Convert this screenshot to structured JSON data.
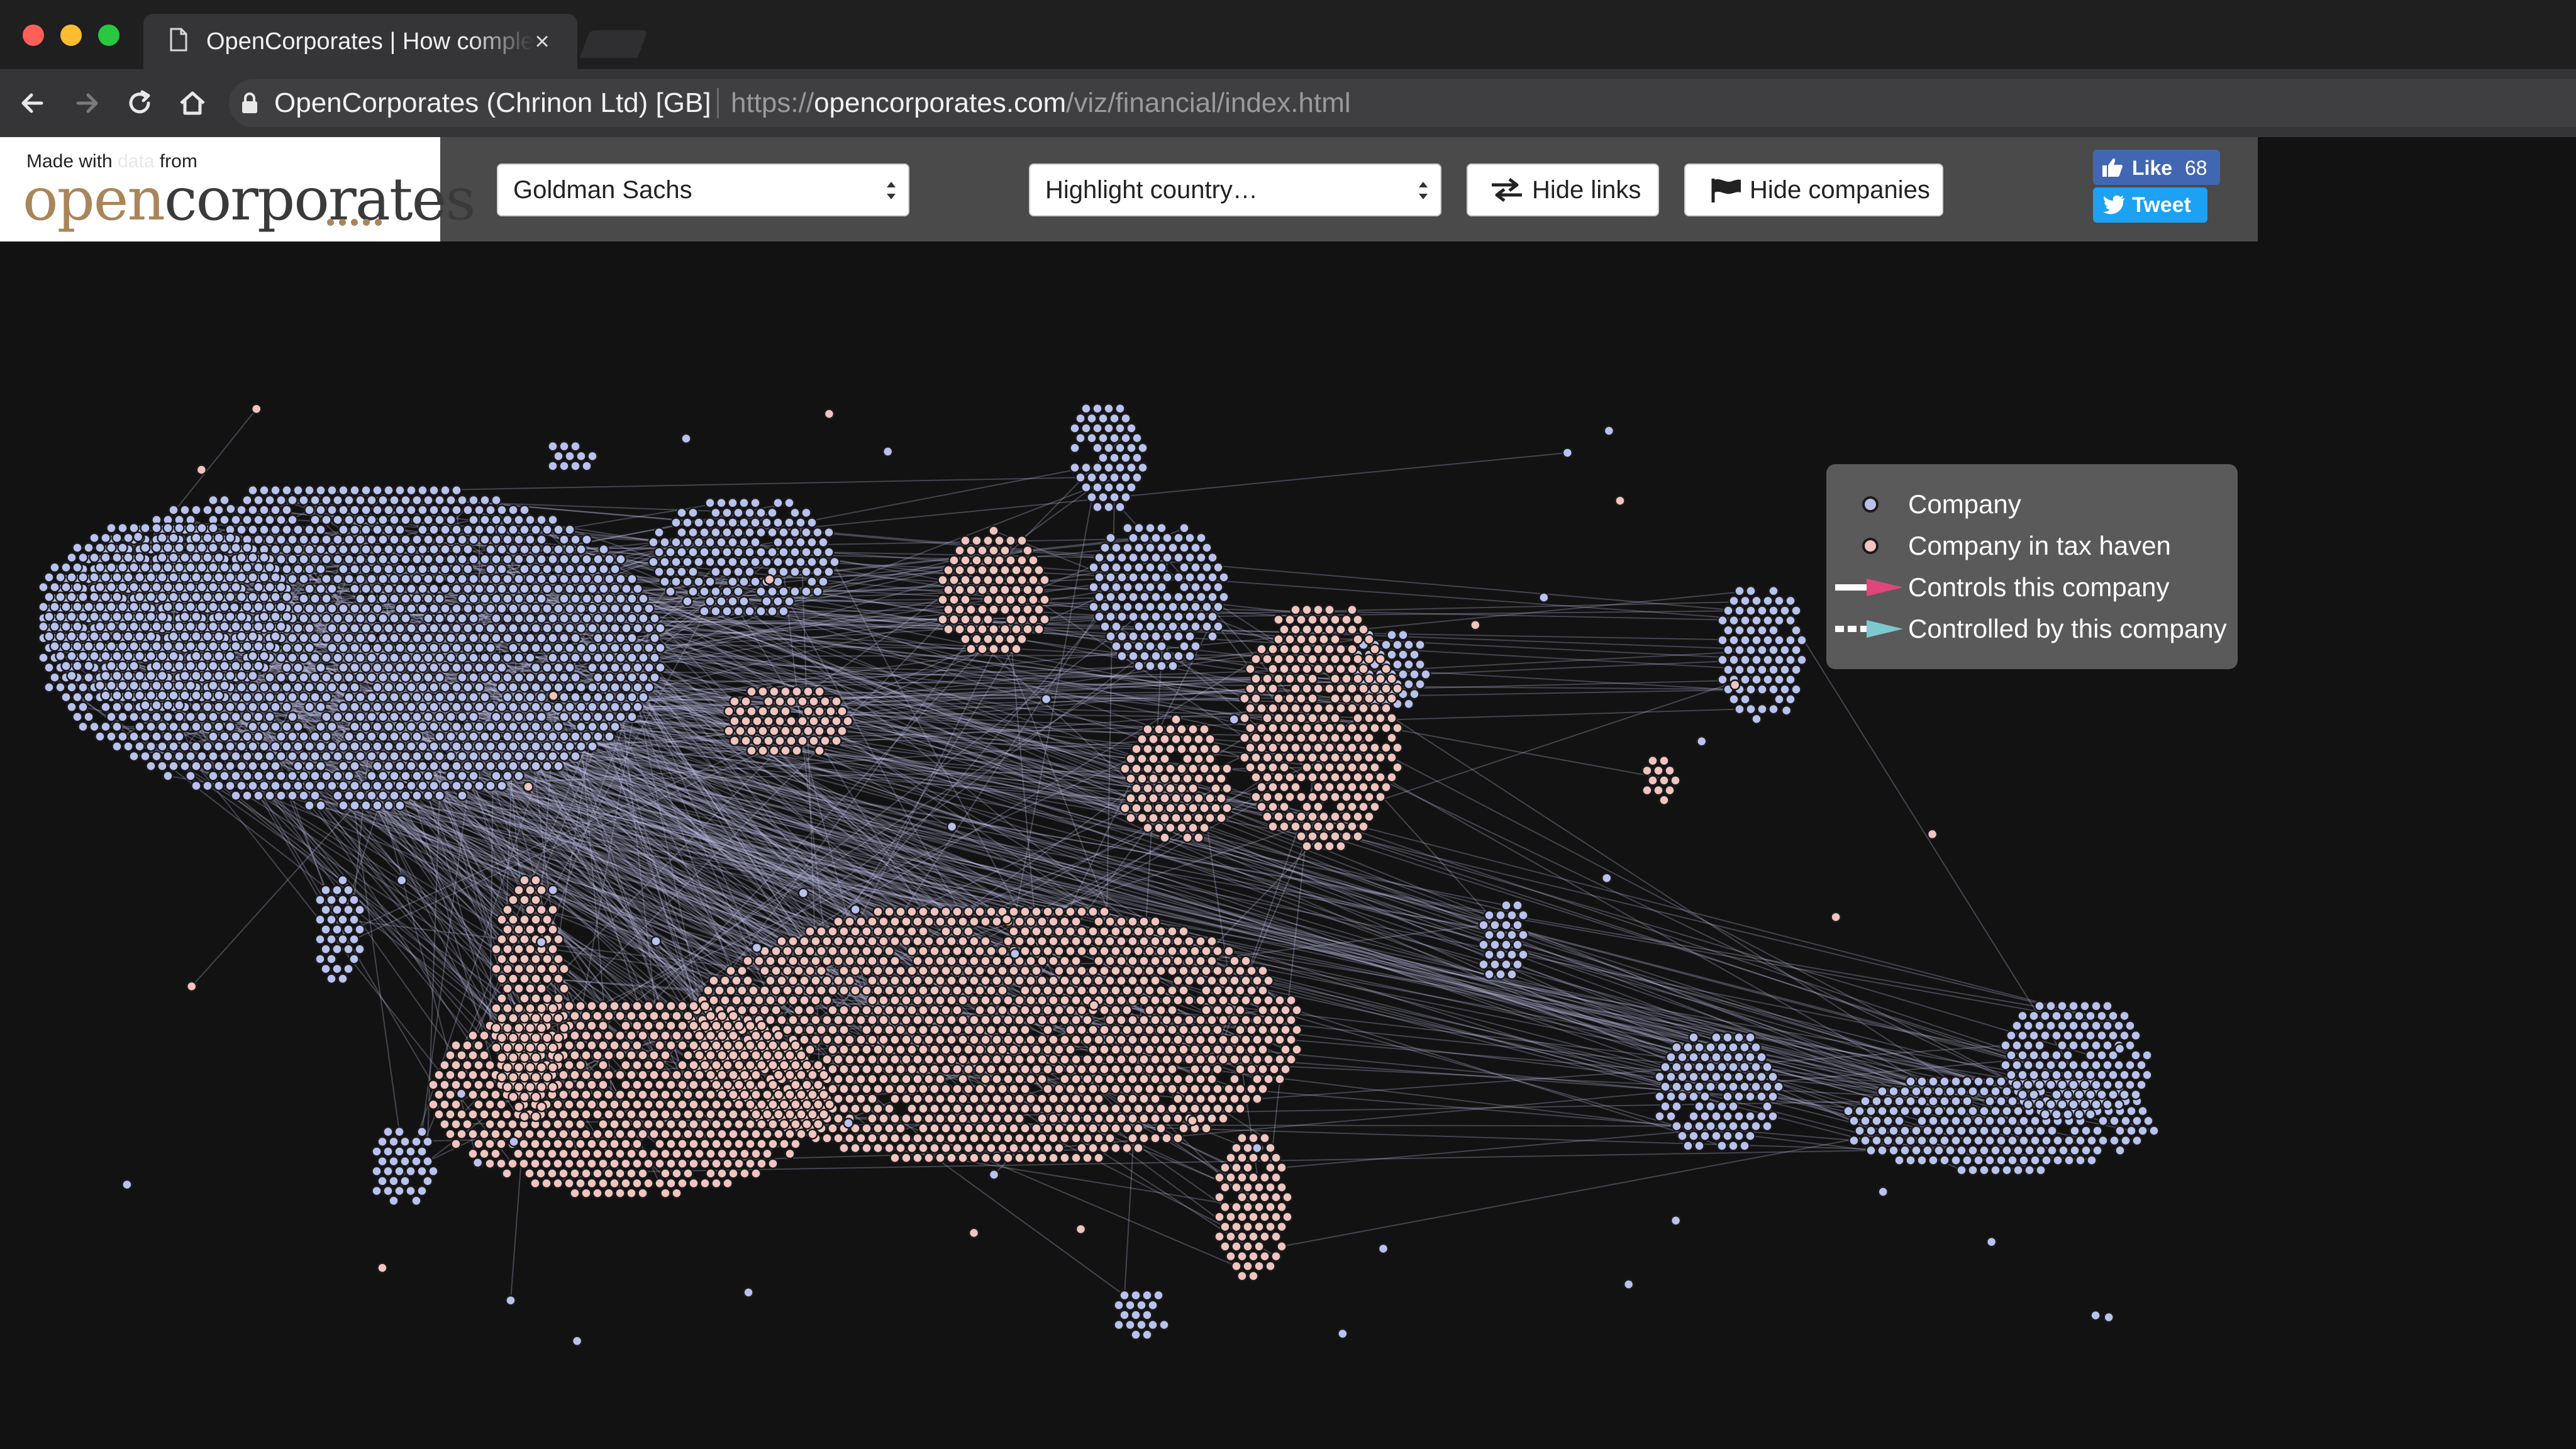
{
  "browser": {
    "tab": {
      "title": "OpenCorporates | How complex are the biggest banks?",
      "close_glyph": "×"
    },
    "omnibox": {
      "site_identity": "OpenCorporates (Chrinon Ltd) [GB]",
      "url_scheme": "https://",
      "url_host": "opencorporates.com",
      "url_path": "/viz/financial/index.html"
    }
  },
  "header": {
    "made_with_prefix": "Made with",
    "made_with_faint": "data",
    "made_with_suffix": "from",
    "logo_open": "open",
    "logo_corporates": "corporates",
    "bank_select": {
      "value": "Goldman Sachs"
    },
    "country_select": {
      "value": "Highlight country…"
    },
    "hide_links_label": "Hide links",
    "hide_companies_label": "Hide companies",
    "like_label": "Like",
    "like_count": "68",
    "tweet_label": "Tweet"
  },
  "legend": {
    "company": "Company",
    "company_tax_haven": "Company in tax haven",
    "controls": "Controls this company",
    "controlled_by": "Controlled by this company"
  },
  "colors": {
    "node_company": "#b9c2ee",
    "node_tax_haven": "#f0c4c0",
    "node_stroke": "#1b1b1b",
    "link": "#c7c4f2",
    "controls_arrow": "#e0457b",
    "controlled_arrow": "#7ec8cf"
  },
  "icons": {
    "back": "arrow-left-icon",
    "forward": "arrow-right-icon",
    "reload": "reload-icon",
    "home": "home-icon",
    "lock": "lock-icon",
    "page": "page-icon",
    "swap": "swap-arrows-icon",
    "flag": "flag-icon",
    "thumb": "thumbs-up-icon",
    "bird": "twitter-bird-icon"
  }
}
